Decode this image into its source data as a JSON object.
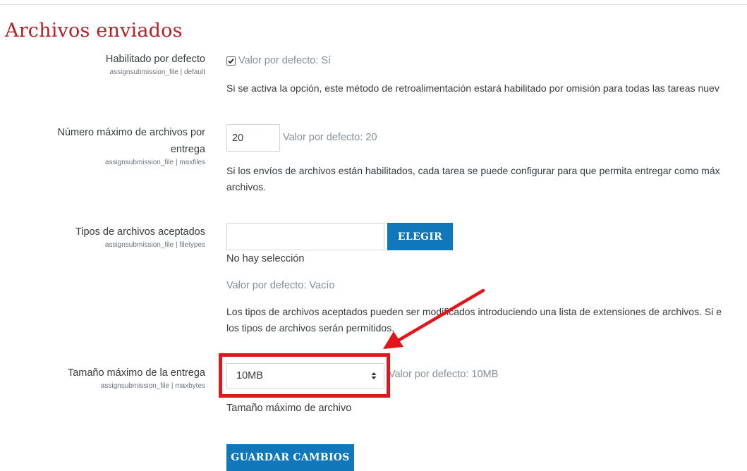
{
  "section": {
    "title": "Archivos enviados"
  },
  "settings": {
    "enabled": {
      "label": "Habilitado por defecto",
      "key": "assignsubmission_file | default",
      "checked": true,
      "default_text": "Valor por defecto: Sí",
      "description": "Si se activa la opción, este método de retroalimentación estará habilitado por omisión para todas las tareas nuev"
    },
    "maxfiles": {
      "label_line1": "Número máximo de archivos por",
      "label_line2": "entrega",
      "key": "assignsubmission_file | maxfiles",
      "value": "20",
      "default_text": "Valor por defecto: 20",
      "description_line1": "Si los envíos de archivos están habilitados, cada tarea se puede configurar para que permita entregar como máx",
      "description_line2": "archivos."
    },
    "filetypes": {
      "label": "Tipos de archivos aceptados",
      "key": "assignsubmission_file | filetypes",
      "value": "",
      "button_label": "ELEGIR",
      "selection_text": "No hay selección",
      "default_text": "Valor por defecto: Vacío",
      "description_line1": "Los tipos de archivos aceptados pueden ser modificados introduciendo una lista de extensiones de archivos. Si e",
      "description_line2": "los tipos de archivos serán permitidos."
    },
    "maxbytes": {
      "label": "Tamaño máximo de la entrega",
      "key": "assignsubmission_file | maxbytes",
      "selected": "10MB",
      "default_text": "Valor por defecto: 10MB",
      "description": "Tamaño máximo de archivo"
    }
  },
  "save_button": "GUARDAR CAMBIOS",
  "colors": {
    "title": "#b41e24",
    "button": "#1177bb",
    "highlight": "#e3141a",
    "muted": "#868e96"
  },
  "icons": {
    "checkbox": "check-icon",
    "select": "updown-chevron-icon",
    "annotation": "red-arrow-icon"
  }
}
